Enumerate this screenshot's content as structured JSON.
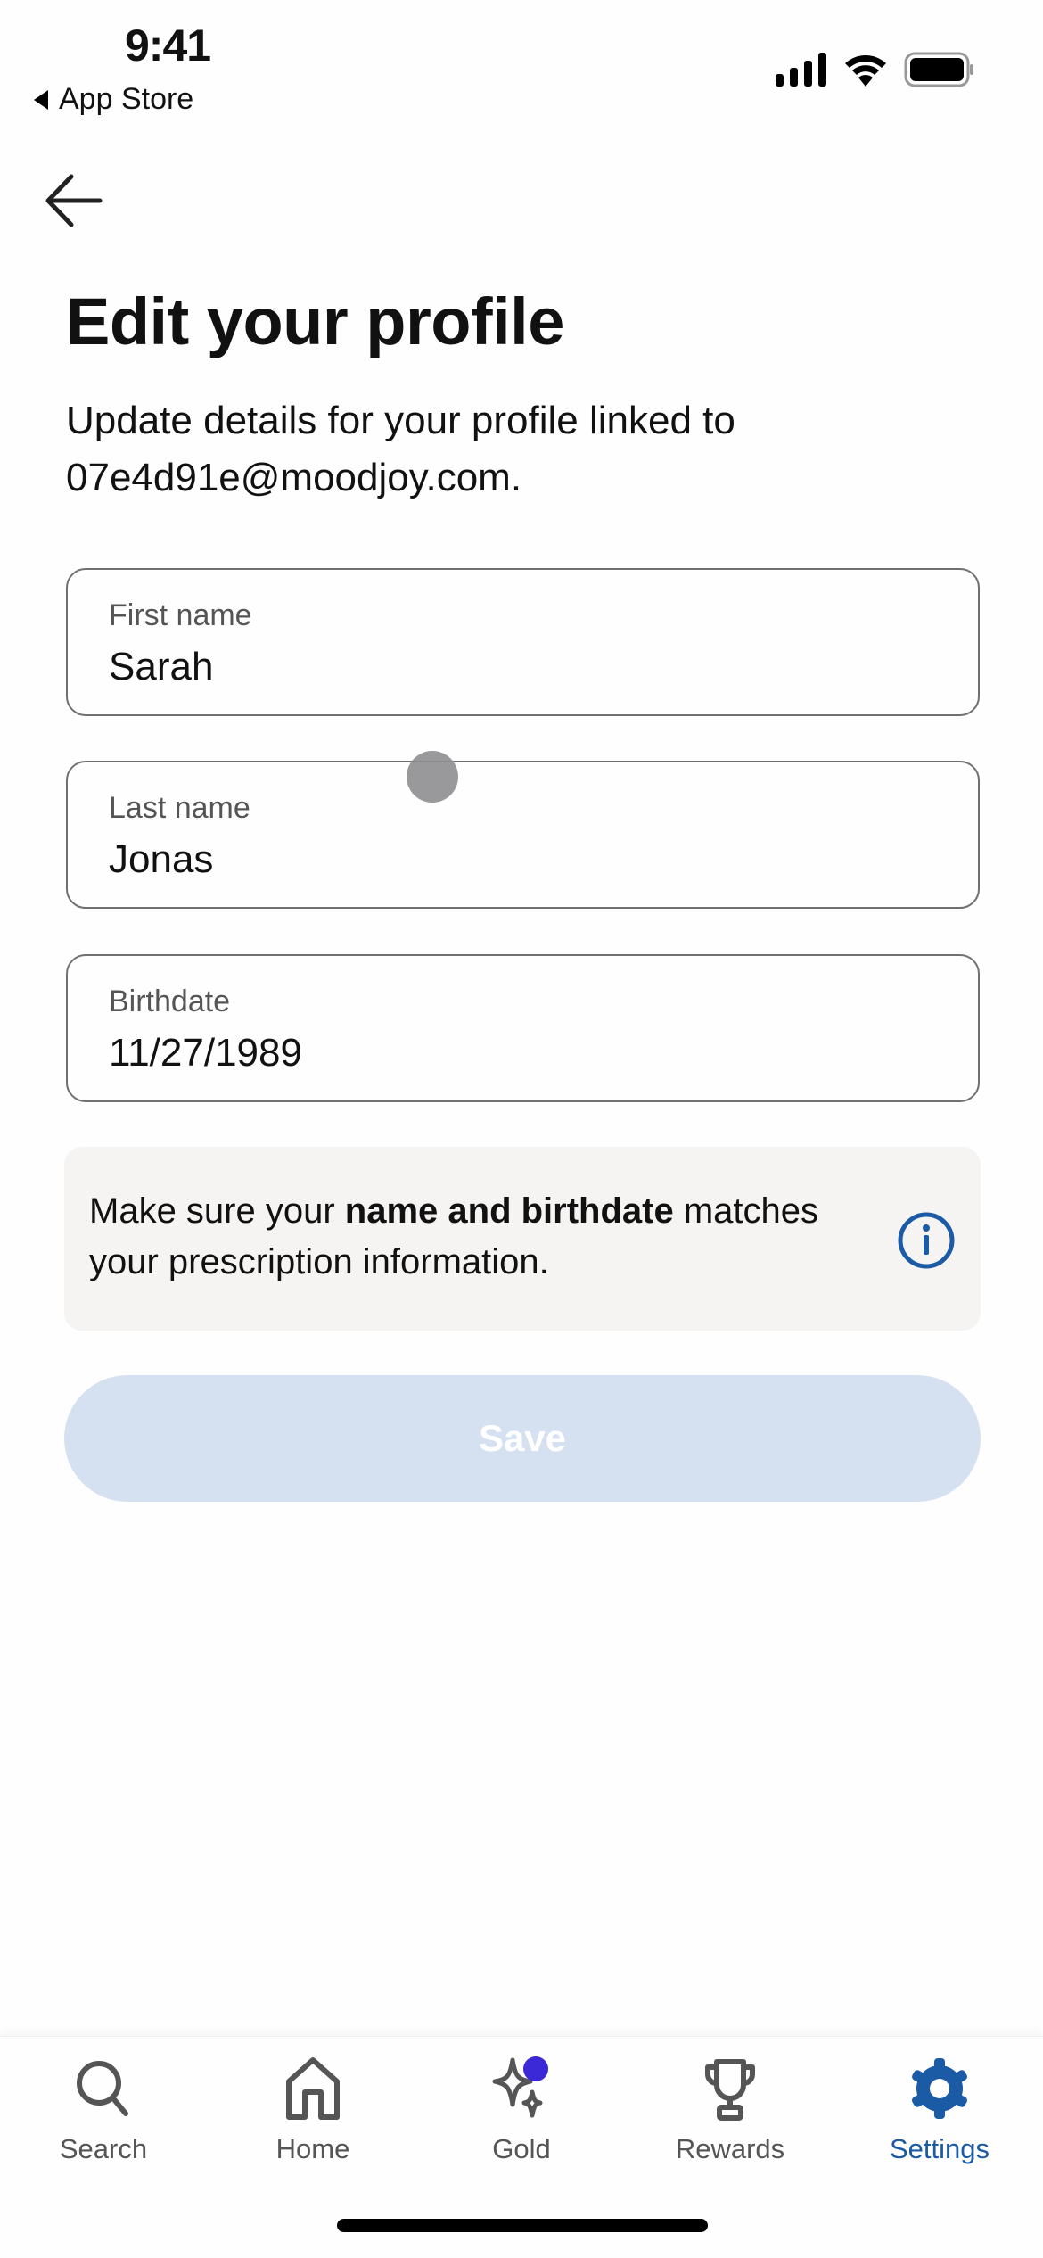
{
  "status_bar": {
    "time": "9:41",
    "back_app": "App Store"
  },
  "header": {
    "title": "Edit your profile",
    "subtitle": "Update details for your profile linked to 07e4d91e@moodjoy.com."
  },
  "form": {
    "first_name": {
      "label": "First name",
      "value": "Sarah"
    },
    "last_name": {
      "label": "Last name",
      "value": "Jonas"
    },
    "birthdate": {
      "label": "Birthdate",
      "value": "11/27/1989"
    }
  },
  "notice": {
    "prefix": "Make sure your ",
    "bold": "name and birthdate",
    "suffix": " matches your prescription information.",
    "icon": "info-icon"
  },
  "save_label": "Save",
  "tabs": [
    {
      "label": "Search",
      "icon": "search-icon"
    },
    {
      "label": "Home",
      "icon": "home-icon"
    },
    {
      "label": "Gold",
      "icon": "sparkle-icon"
    },
    {
      "label": "Rewards",
      "icon": "trophy-icon"
    },
    {
      "label": "Settings",
      "icon": "gear-icon",
      "active": true
    }
  ],
  "colors": {
    "accent": "#1b5aa5",
    "save_disabled": "#d5e1f1",
    "gold_dot": "#3b28d6",
    "notice_bg": "#f6f4f2"
  }
}
